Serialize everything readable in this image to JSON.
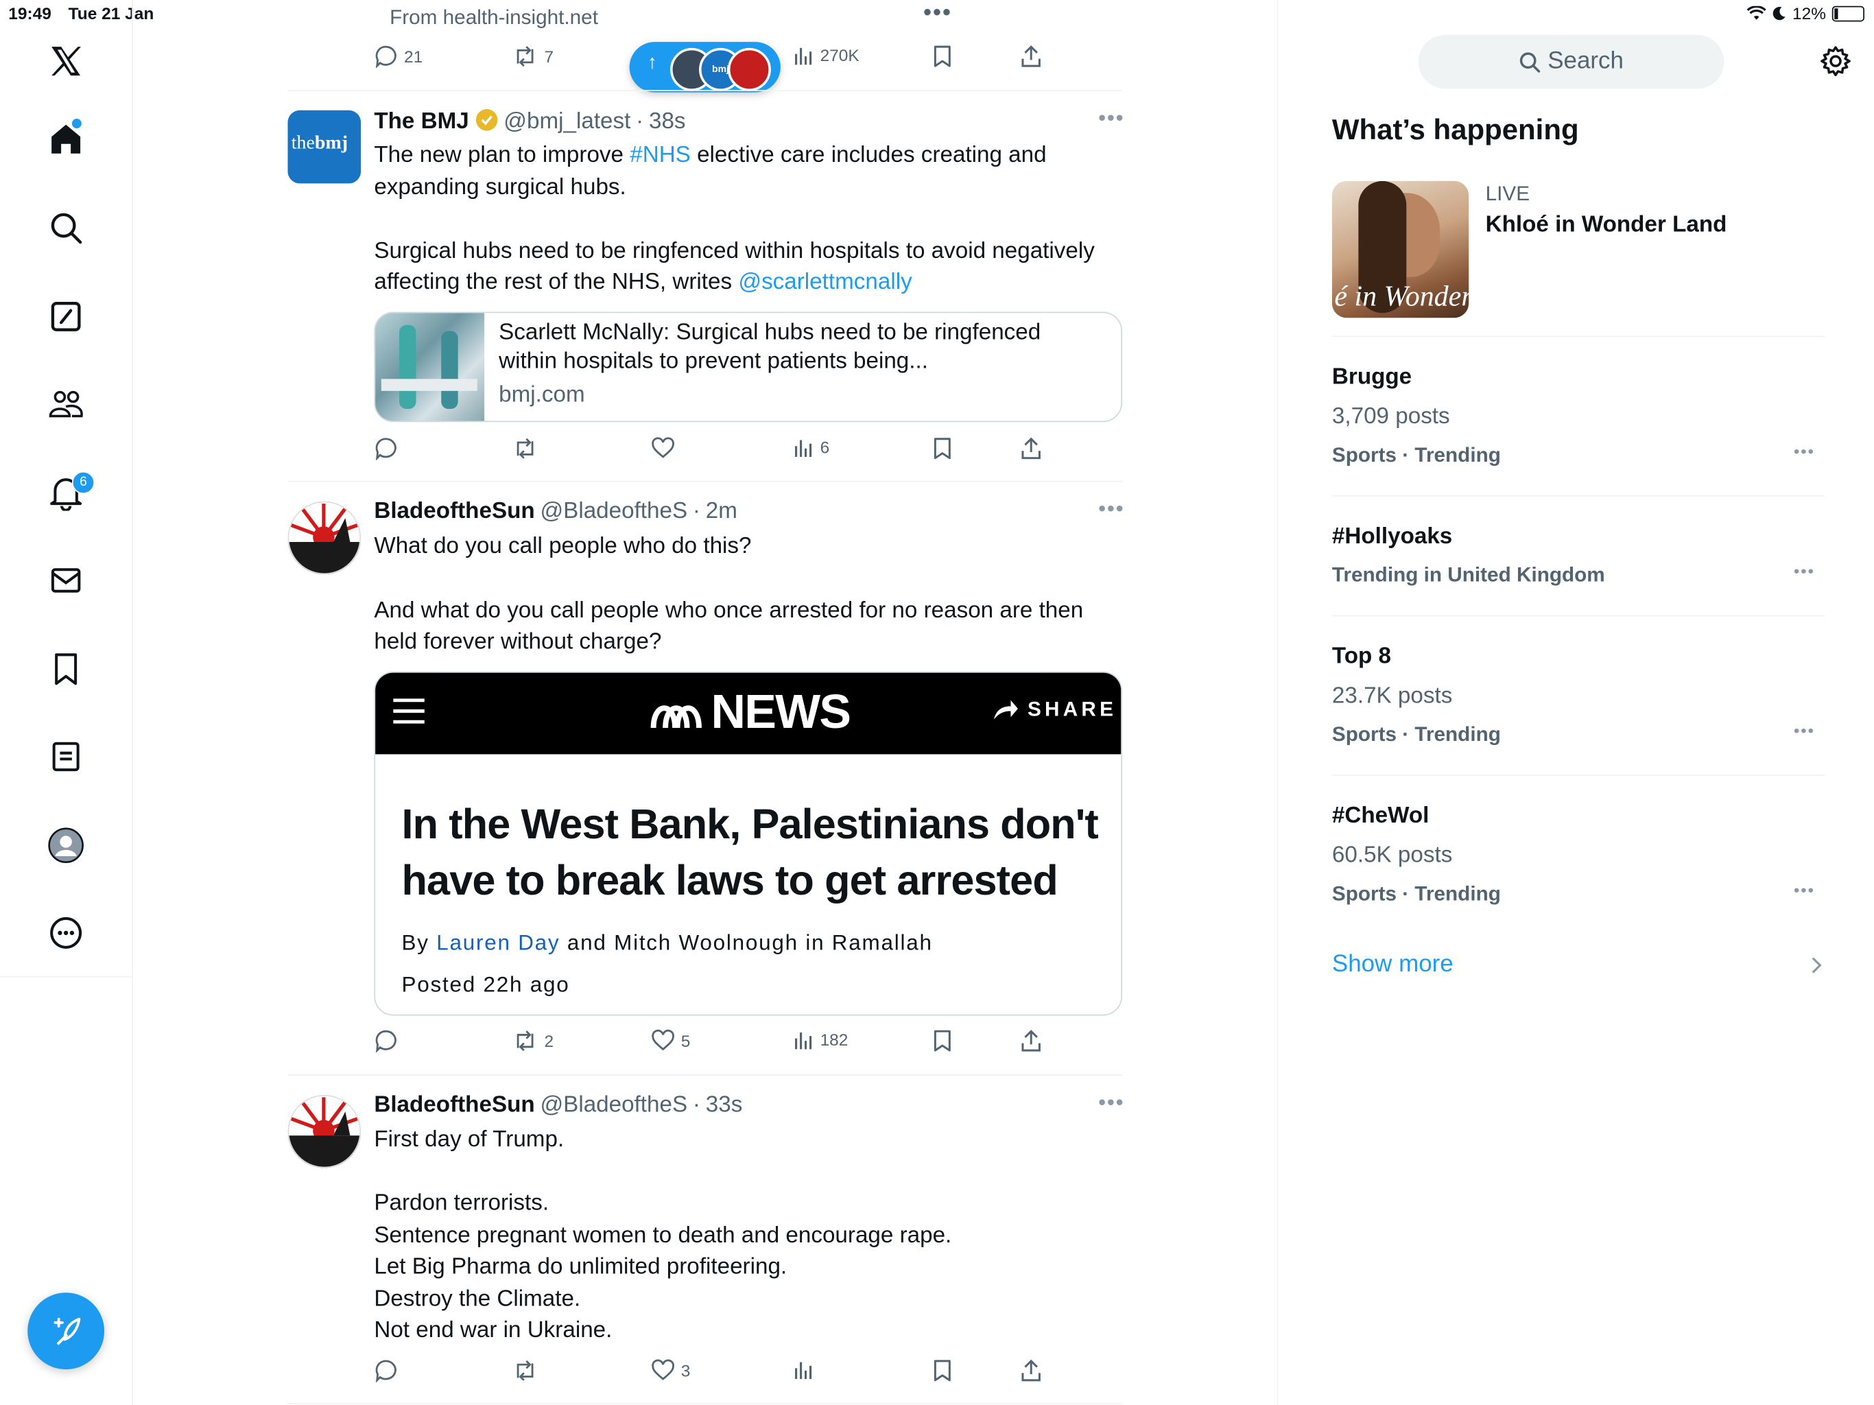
{
  "status_bar": {
    "time": "19:49",
    "date": "Tue 21 Jan",
    "battery": "12%"
  },
  "nav": {
    "items": [
      "home",
      "explore",
      "grok",
      "communities",
      "notifications",
      "messages",
      "bookmarks",
      "lists",
      "profile",
      "more"
    ],
    "notifications_count": "6"
  },
  "top_tweet": {
    "source": "From health-insight.net",
    "replies": "21",
    "retweets": "7",
    "views": "270K",
    "new_posts_pill_arrow": "↑",
    "pill_avatar_label": "bmj"
  },
  "tweets": [
    {
      "name": "The BMJ",
      "handle": "@bmj_latest",
      "time": "38s",
      "avatar_text_a": "the",
      "avatar_text_b": "bmj",
      "text_line1_pre": "The new plan to improve ",
      "text_line1_tag": "#NHS",
      "text_line1_post": " elective care includes creating and",
      "text_line2": "expanding surgical hubs.",
      "text_line3": "Surgical hubs need to be ringfenced within hospitals to avoid negatively",
      "text_line4_pre": "affecting the rest of the NHS, writes ",
      "text_line4_mention": "@scarlettmcnally",
      "card_title_line1": "Scarlett McNally: Surgical hubs need to be ringfenced",
      "card_title_line2": "within hospitals to prevent patients being...",
      "card_domain": "bmj.com",
      "replies": "",
      "retweets": "",
      "likes": "",
      "views": "6"
    },
    {
      "name": "BladeoftheSun",
      "handle": "@BladeoftheS",
      "time": "2m",
      "text_line1": "What do you call people who do this?",
      "text_line2": "And what do you call people who once arrested for no reason are then",
      "text_line3": "held forever without charge?",
      "news_brand": "NEWS",
      "news_share": "SHARE",
      "news_headline_line1": "In the West Bank, Palestinians don't",
      "news_headline_line2": "have to break laws to get arrested",
      "news_byline_pre": "By ",
      "news_byline_author": "Lauren Day",
      "news_byline_post": " and Mitch Woolnough in Ramallah",
      "news_posted": "Posted 22h ago",
      "replies": "",
      "retweets": "2",
      "likes": "5",
      "views": "182"
    },
    {
      "name": "BladeoftheSun",
      "handle": "@BladeoftheS",
      "time": "33s",
      "lines": [
        "First day of Trump.",
        "Pardon terrorists.",
        "Sentence pregnant women to death and encourage rape.",
        "Let Big Pharma do unlimited profiteering.",
        "Destroy the Climate.",
        "Not end war in Ukraine."
      ],
      "replies": "",
      "retweets": "",
      "likes": "3",
      "views": ""
    }
  ],
  "sidebar": {
    "search_placeholder": "Search",
    "heading": "What’s happening",
    "live": {
      "label": "LIVE",
      "title": "Khloé in Wonder Land",
      "thumb_text": "é in Wonder L"
    },
    "trends": [
      {
        "title": "Brugge",
        "posts": "3,709 posts",
        "context": "Sports · Trending"
      },
      {
        "title": "#Hollyoaks",
        "posts": "",
        "context": "Trending in United Kingdom"
      },
      {
        "title": "Top 8",
        "posts": "23.7K posts",
        "context": "Sports · Trending"
      },
      {
        "title": "#CheWol",
        "posts": "60.5K posts",
        "context": "Sports · Trending"
      }
    ],
    "show_more": "Show more"
  },
  "colors": {
    "accent": "#1d9bf0",
    "text": "#0f1419",
    "muted": "#536471",
    "border": "#eff3f4",
    "verified_gold": "#e8b829",
    "bmj_blue": "#1a74c4"
  }
}
